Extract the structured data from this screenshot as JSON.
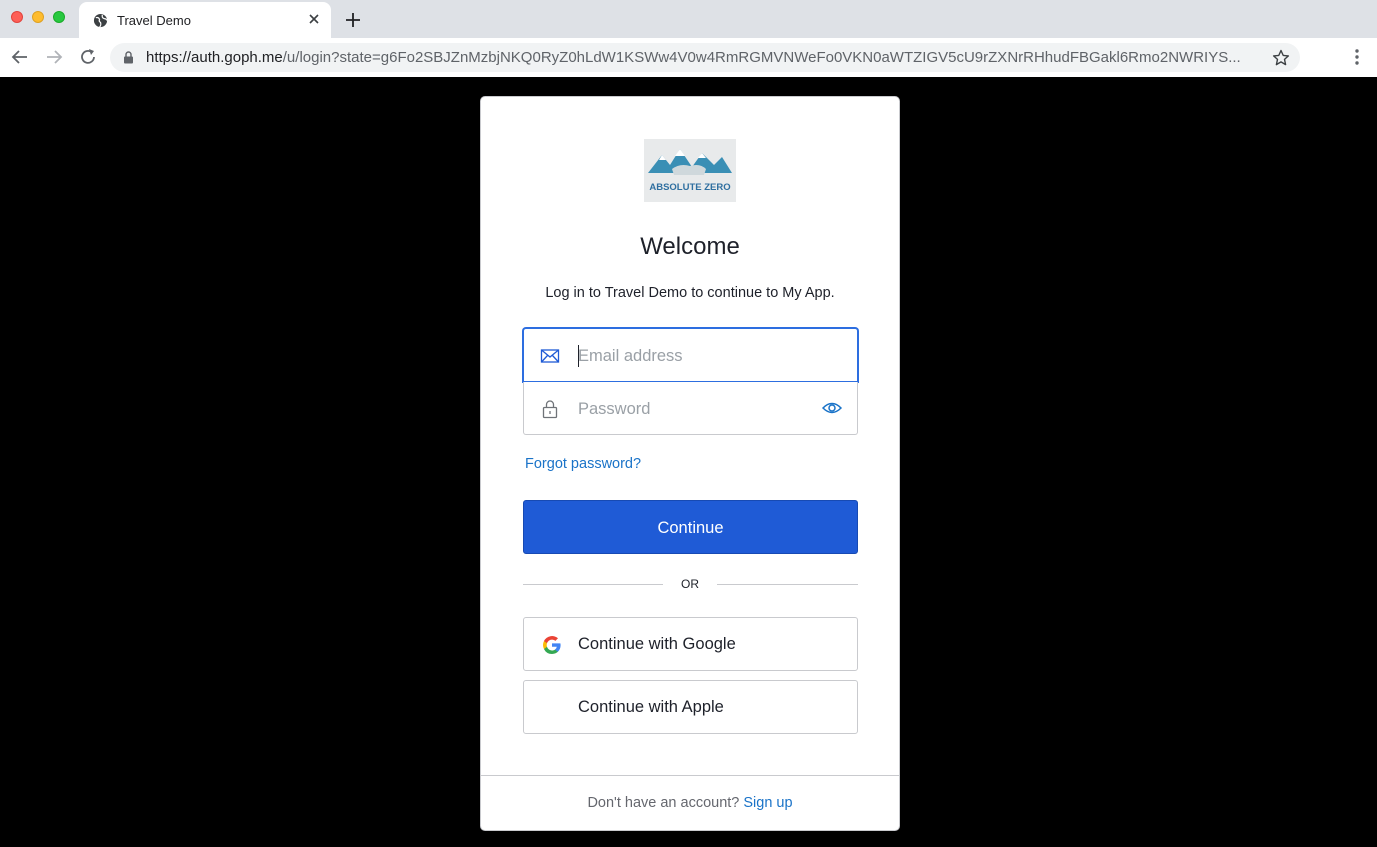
{
  "browser": {
    "tab_title": "Travel Demo",
    "url_host": "https://auth.goph.me",
    "url_path": "/u/login?state=g6Fo2SBJZnMzbjNKQ0RyZ0hLdW1KSWw4V0w4RmRGMVNWeFo0VKN0aWTZIGV5cU9rZXNrRHhudFBGakl6Rmo2NWRIYS..."
  },
  "login": {
    "logo_text": "ABSOLUTE ZERO",
    "title": "Welcome",
    "subtitle": "Log in to Travel Demo to continue to My App.",
    "email_placeholder": "Email address",
    "email_value": "",
    "password_placeholder": "Password",
    "password_value": "",
    "forgot_label": "Forgot password?",
    "continue_label": "Continue",
    "or_label": "OR",
    "google_label": "Continue with Google",
    "apple_label": "Continue with Apple",
    "no_account_text": "Don't have an account?",
    "signup_label": "Sign up"
  },
  "colors": {
    "primary": "#1f5bd6",
    "link": "#1a73c8",
    "page_background": "#000000"
  }
}
